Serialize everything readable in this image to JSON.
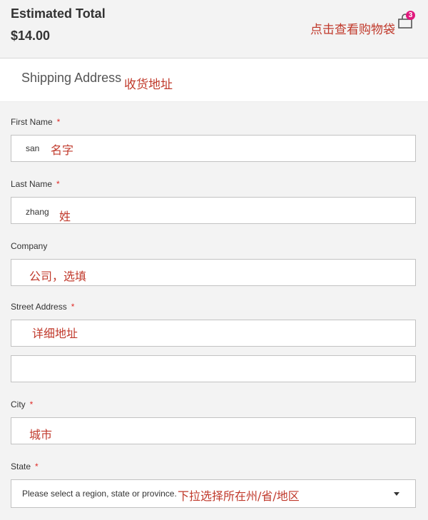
{
  "summary": {
    "title": "Estimated Total",
    "price": "$14.00",
    "cart_note": "点击查看购物袋",
    "cart_count": "3"
  },
  "shipping": {
    "title": "Shipping Address",
    "note": "收货地址"
  },
  "form": {
    "first_name": {
      "label": "First Name",
      "required": "*",
      "value": "san",
      "note": "名字"
    },
    "last_name": {
      "label": "Last Name",
      "required": "*",
      "value": "zhang",
      "note": "姓"
    },
    "company": {
      "label": "Company",
      "value": "",
      "note": "公司，选填"
    },
    "street": {
      "label": "Street Address",
      "required": "*",
      "value": "",
      "value2": "",
      "note": "详细地址"
    },
    "city": {
      "label": "City",
      "required": "*",
      "value": "",
      "note": "城市"
    },
    "state": {
      "label": "State",
      "required": "*",
      "placeholder": "Please select a region, state or province.",
      "note": "下拉选择所在州/省/地区"
    }
  },
  "colors": {
    "annotation": "#c0392b",
    "required": "#e02b27",
    "badge": "#e0197d"
  }
}
